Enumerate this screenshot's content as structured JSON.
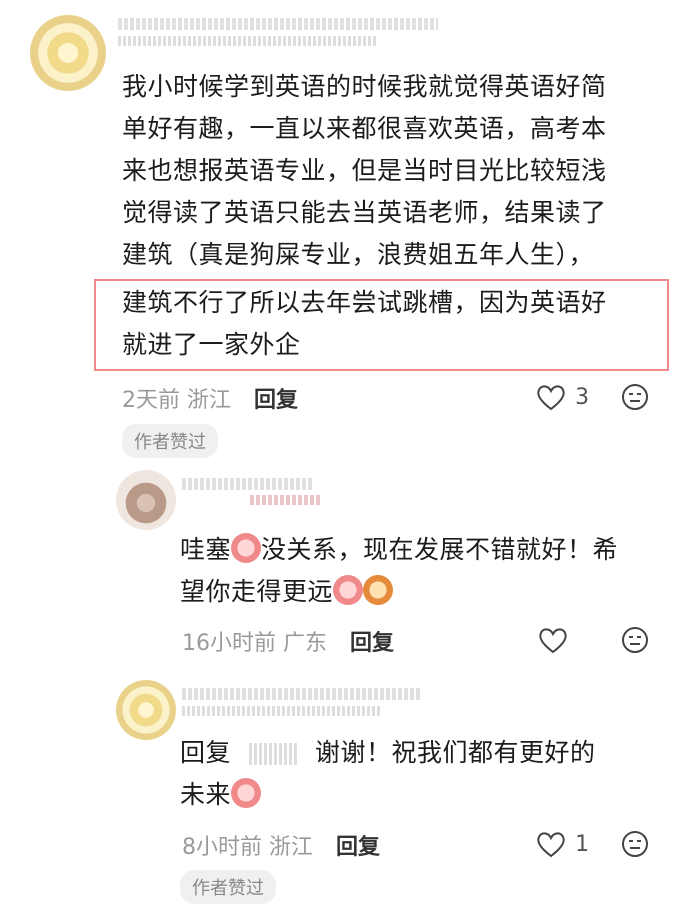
{
  "comment_main": {
    "lines": [
      "我小时候学到英语的时候我就觉得英语好简",
      "单好有趣，一直以来都很喜欢英语，高考本",
      "来也想报英语专业，但是当时目光比较短浅",
      "觉得读了英语只能去当英语老师，结果读了",
      "建筑（真是狗屎专业，浪费姐五年人生），"
    ],
    "highlight_lines": [
      "建筑不行了所以去年尝试跳槽，因为英语好",
      "就进了一家外企"
    ],
    "time": "2天前",
    "location": "浙江",
    "reply_label": "回复",
    "like_count": "3",
    "badge": "作者赞过"
  },
  "reply1": {
    "line1_pre": "哇塞",
    "line1_post": "没关系，现在发展不错就好！希",
    "line2": "望你走得更远",
    "time": "16小时前",
    "location": "广东",
    "reply_label": "回复"
  },
  "reply2": {
    "prefix": "回复",
    "line1_post": "谢谢！祝我们都有更好的",
    "line2": "未来",
    "time": "8小时前",
    "location": "浙江",
    "reply_label": "回复",
    "like_count": "1",
    "badge": "作者赞过"
  },
  "icons": [
    "heart-icon",
    "emoji-face-icon"
  ],
  "colors": {
    "highlight_border": "#f08a8a",
    "badge_bg": "#f0f0f0"
  }
}
